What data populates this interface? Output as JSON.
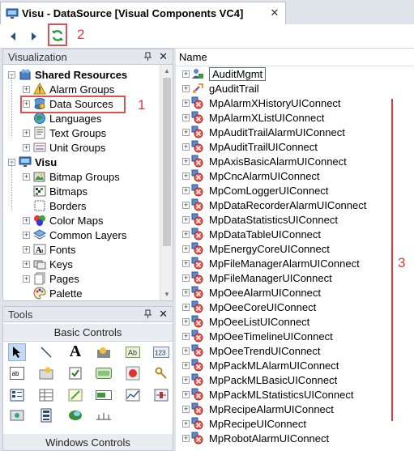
{
  "tab": {
    "title": "Visu - DataSource [Visual Components VC4]",
    "close": "✕"
  },
  "callouts": {
    "one": "1",
    "two": "2",
    "three": "3"
  },
  "visualization": {
    "title": "Visualization",
    "close": "✕",
    "tree": [
      {
        "label": "Shared Resources",
        "level": 0,
        "bold": true,
        "expander": "−",
        "icon": "shared-resources-icon"
      },
      {
        "label": "Alarm Groups",
        "level": 1,
        "expander": "+",
        "icon": "alarm-groups-icon"
      },
      {
        "label": "Data Sources",
        "level": 1,
        "expander": "+",
        "icon": "data-sources-icon"
      },
      {
        "label": "Languages",
        "level": 1,
        "expander": "",
        "icon": "languages-icon"
      },
      {
        "label": "Text Groups",
        "level": 1,
        "expander": "+",
        "icon": "text-groups-icon"
      },
      {
        "label": "Unit Groups",
        "level": 1,
        "expander": "+",
        "icon": "unit-groups-icon"
      },
      {
        "label": "Visu",
        "level": 0,
        "bold": true,
        "expander": "−",
        "icon": "visu-icon"
      },
      {
        "label": "Bitmap Groups",
        "level": 1,
        "expander": "+",
        "icon": "bitmap-groups-icon"
      },
      {
        "label": "Bitmaps",
        "level": 1,
        "expander": "",
        "icon": "bitmaps-icon"
      },
      {
        "label": "Borders",
        "level": 1,
        "expander": "",
        "icon": "borders-icon"
      },
      {
        "label": "Color Maps",
        "level": 1,
        "expander": "+",
        "icon": "color-maps-icon"
      },
      {
        "label": "Common Layers",
        "level": 1,
        "expander": "+",
        "icon": "common-layers-icon"
      },
      {
        "label": "Fonts",
        "level": 1,
        "expander": "+",
        "icon": "fonts-icon"
      },
      {
        "label": "Keys",
        "level": 1,
        "expander": "+",
        "icon": "keys-icon"
      },
      {
        "label": "Pages",
        "level": 1,
        "expander": "+",
        "icon": "pages-icon"
      },
      {
        "label": "Palette",
        "level": 1,
        "expander": "",
        "icon": "palette-icon"
      }
    ]
  },
  "tools": {
    "title": "Tools",
    "close": "✕",
    "basic_controls": "Basic Controls",
    "windows_controls": "Windows Controls"
  },
  "list": {
    "header": "Name",
    "items": [
      {
        "label": "AuditMgmt",
        "icon": "user-icon",
        "selected": true
      },
      {
        "label": "gAuditTrail",
        "icon": "variable-icon"
      },
      {
        "label": "MpAlarmXHistoryUIConnect",
        "icon": "connect-icon"
      },
      {
        "label": "MpAlarmXListUIConnect",
        "icon": "connect-icon"
      },
      {
        "label": "MpAuditTrailAlarmUIConnect",
        "icon": "connect-icon"
      },
      {
        "label": "MpAuditTrailUIConnect",
        "icon": "connect-icon"
      },
      {
        "label": "MpAxisBasicAlarmUIConnect",
        "icon": "connect-icon"
      },
      {
        "label": "MpCncAlarmUIConnect",
        "icon": "connect-icon"
      },
      {
        "label": "MpComLoggerUIConnect",
        "icon": "connect-icon"
      },
      {
        "label": "MpDataRecorderAlarmUIConnect",
        "icon": "connect-icon"
      },
      {
        "label": "MpDataStatisticsUIConnect",
        "icon": "connect-icon"
      },
      {
        "label": "MpDataTableUIConnect",
        "icon": "connect-icon"
      },
      {
        "label": "MpEnergyCoreUIConnect",
        "icon": "connect-icon"
      },
      {
        "label": "MpFileManagerAlarmUIConnect",
        "icon": "connect-icon"
      },
      {
        "label": "MpFileManagerUIConnect",
        "icon": "connect-icon"
      },
      {
        "label": "MpOeeAlarmUIConnect",
        "icon": "connect-icon"
      },
      {
        "label": "MpOeeCoreUIConnect",
        "icon": "connect-icon"
      },
      {
        "label": "MpOeeListUIConnect",
        "icon": "connect-icon"
      },
      {
        "label": "MpOeeTimelineUIConnect",
        "icon": "connect-icon"
      },
      {
        "label": "MpOeeTrendUIConnect",
        "icon": "connect-icon"
      },
      {
        "label": "MpPackMLAlarmUIConnect",
        "icon": "connect-icon"
      },
      {
        "label": "MpPackMLBasicUIConnect",
        "icon": "connect-icon"
      },
      {
        "label": "MpPackMLStatisticsUIConnect",
        "icon": "connect-icon"
      },
      {
        "label": "MpRecipeAlarmUIConnect",
        "icon": "connect-icon"
      },
      {
        "label": "MpRecipeUIConnect",
        "icon": "connect-icon"
      },
      {
        "label": "MpRobotAlarmUIConnect",
        "icon": "connect-icon"
      }
    ]
  },
  "colors": {
    "accent_red": "#e0393e",
    "selection": "#c7d9ee"
  }
}
